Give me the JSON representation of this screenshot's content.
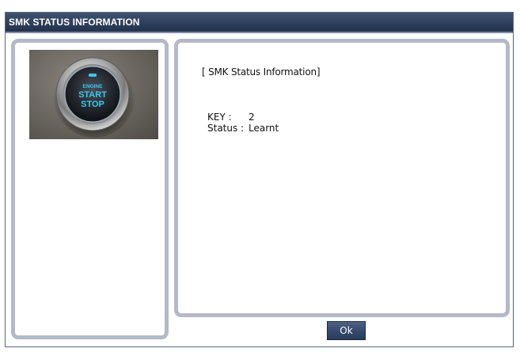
{
  "window": {
    "title": "SMK STATUS INFORMATION"
  },
  "key_image": {
    "icon": "engine-start-stop-button",
    "line1": "ENGINE",
    "line2": "START",
    "line3": "STOP"
  },
  "info": {
    "heading": "[ SMK Status Information]",
    "key_label": "KEY :",
    "key_value": "2",
    "status_label": "Status :",
    "status_value": "Learnt"
  },
  "buttons": {
    "ok_label": "Ok"
  },
  "colors": {
    "title_bar": "#2c3d58",
    "panel_border": "#b4b9c8",
    "button_bg": "#34496a",
    "start_stop_glow": "#38c8f0"
  }
}
